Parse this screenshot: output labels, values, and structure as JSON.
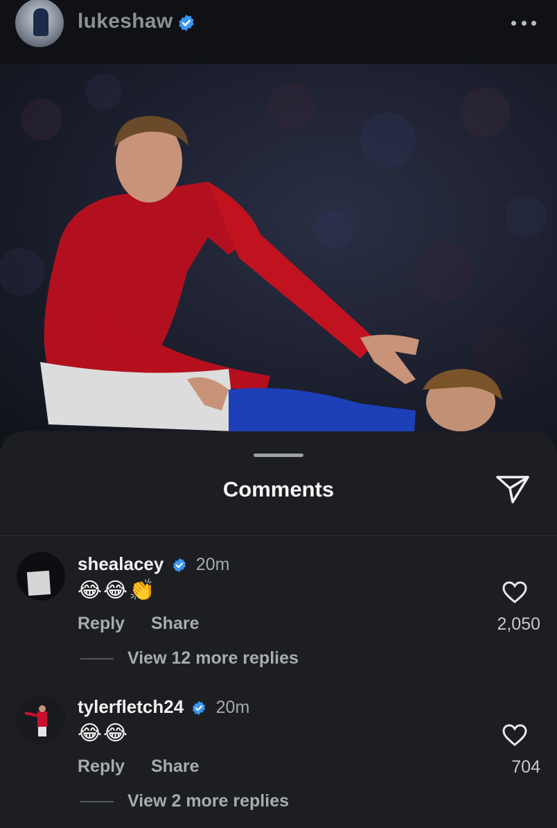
{
  "header": {
    "username": "lukeshaw",
    "verified_icon": "verified-badge-icon",
    "more_icon": "more-options-icon"
  },
  "post": {
    "image_icon": "football-photo"
  },
  "sheet": {
    "title": "Comments",
    "share_icon": "send-icon"
  },
  "comments": [
    {
      "username": "shealacey",
      "time": "20m",
      "emoji": "😂😂👏",
      "reply_label": "Reply",
      "share_label": "Share",
      "likes": "2,050",
      "view_replies": "View 12 more replies"
    },
    {
      "username": "tylerfletch24",
      "time": "20m",
      "emoji": "😂😂",
      "reply_label": "Reply",
      "share_label": "Share",
      "likes": "704",
      "view_replies": "View 2 more replies"
    }
  ],
  "colors": {
    "background": "#1c1e22",
    "verified_blue": "#3897f0",
    "kit_red": "#c8102e",
    "kit_blue": "#1d3fb8"
  }
}
